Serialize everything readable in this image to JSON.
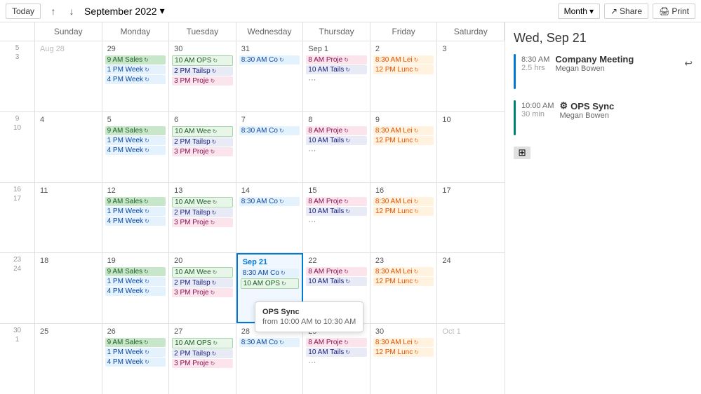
{
  "toolbar": {
    "today_label": "Today",
    "nav_up": "↑",
    "nav_down": "↓",
    "month_title": "September 2022",
    "month_dropdown": "▾",
    "share_label": "Share",
    "print_label": "Print",
    "view_label": "Month",
    "view_icon": "▾"
  },
  "panel": {
    "date": "Wed, Sep 21",
    "event1": {
      "time": "8:30 AM",
      "duration": "2.5 hrs",
      "title": "Company Meeting",
      "organizer": "Megan Bowen",
      "bar_color": "blue"
    },
    "event2": {
      "time": "10:00 AM",
      "duration": "30 min",
      "title": "OPS Sync",
      "organizer": "Megan Bowen",
      "bar_color": "teal"
    }
  },
  "day_headers": [
    "Sunday",
    "Monday",
    "Tuesday",
    "Wednesday",
    "Thursday",
    "Friday",
    "Saturday"
  ],
  "weeks": [
    {
      "nums": [
        "5",
        "3"
      ],
      "days": [
        {
          "label": "Aug 28",
          "other": true,
          "events": []
        },
        {
          "label": "29",
          "events": [
            {
              "text": "9 AM Sales",
              "cls": "event-sales",
              "recur": true
            },
            {
              "text": "1 PM Week",
              "cls": "event-week",
              "recur": true
            },
            {
              "text": "4 PM Week",
              "cls": "event-week",
              "recur": true
            }
          ]
        },
        {
          "label": "30",
          "events": [
            {
              "text": "10 AM OPS",
              "cls": "event-ops",
              "recur": true
            },
            {
              "text": "2 PM Tailsp",
              "cls": "event-tail",
              "recur": true
            },
            {
              "text": "3 PM Proje",
              "cls": "event-proj",
              "recur": true
            }
          ]
        },
        {
          "label": "31",
          "events": [
            {
              "text": "8:30 AM Co",
              "cls": "event-co",
              "recur": true
            }
          ]
        },
        {
          "label": "Sep 1",
          "events": [
            {
              "text": "8 AM Proje",
              "cls": "event-proj",
              "recur": true
            },
            {
              "text": "10 AM Tails",
              "cls": "event-tail",
              "recur": true
            },
            {
              "text": "···",
              "cls": "more-dots",
              "dots": true
            }
          ]
        },
        {
          "label": "2",
          "events": [
            {
              "text": "8:30 AM Lei",
              "cls": "event-lun",
              "recur": true
            },
            {
              "text": "12 PM Lunc",
              "cls": "event-lun",
              "recur": true
            }
          ]
        },
        {
          "label": "3",
          "events": []
        }
      ]
    },
    {
      "nums": [
        "9",
        "10"
      ],
      "days": [
        {
          "label": "4",
          "events": []
        },
        {
          "label": "5",
          "events": [
            {
              "text": "9 AM Sales",
              "cls": "event-sales",
              "recur": true
            },
            {
              "text": "1 PM Week",
              "cls": "event-week",
              "recur": true
            },
            {
              "text": "4 PM Week",
              "cls": "event-week",
              "recur": true
            }
          ]
        },
        {
          "label": "6",
          "events": [
            {
              "text": "10 AM Wee",
              "cls": "event-ops",
              "recur": true
            },
            {
              "text": "2 PM Tailsp",
              "cls": "event-tail",
              "recur": true
            },
            {
              "text": "3 PM Proje",
              "cls": "event-proj",
              "recur": true
            }
          ]
        },
        {
          "label": "7",
          "events": [
            {
              "text": "8:30 AM Co",
              "cls": "event-co",
              "recur": true
            }
          ]
        },
        {
          "label": "8",
          "events": [
            {
              "text": "8 AM Proje",
              "cls": "event-proj",
              "recur": true
            },
            {
              "text": "10 AM Tails",
              "cls": "event-tail",
              "recur": true
            },
            {
              "text": "···",
              "cls": "more-dots",
              "dots": true
            }
          ]
        },
        {
          "label": "9",
          "events": [
            {
              "text": "8:30 AM Lei",
              "cls": "event-lun",
              "recur": true
            },
            {
              "text": "12 PM Lunc",
              "cls": "event-lun",
              "recur": true
            }
          ]
        },
        {
          "label": "10",
          "events": []
        }
      ]
    },
    {
      "nums": [
        "16",
        "17"
      ],
      "days": [
        {
          "label": "11",
          "events": []
        },
        {
          "label": "12",
          "events": [
            {
              "text": "9 AM Sales",
              "cls": "event-sales",
              "recur": true
            },
            {
              "text": "1 PM Week",
              "cls": "event-week",
              "recur": true
            },
            {
              "text": "4 PM Week",
              "cls": "event-week",
              "recur": true
            }
          ]
        },
        {
          "label": "13",
          "events": [
            {
              "text": "10 AM Wee",
              "cls": "event-ops",
              "recur": true
            },
            {
              "text": "2 PM Tailsp",
              "cls": "event-tail",
              "recur": true
            },
            {
              "text": "3 PM Proje",
              "cls": "event-proj",
              "recur": true
            }
          ]
        },
        {
          "label": "14",
          "events": [
            {
              "text": "8:30 AM Co",
              "cls": "event-co",
              "recur": true
            }
          ]
        },
        {
          "label": "15",
          "events": [
            {
              "text": "8 AM Proje",
              "cls": "event-proj",
              "recur": true
            },
            {
              "text": "10 AM Tails",
              "cls": "event-tail",
              "recur": true
            },
            {
              "text": "···",
              "cls": "more-dots",
              "dots": true
            }
          ]
        },
        {
          "label": "16",
          "events": [
            {
              "text": "8:30 AM Lei",
              "cls": "event-lun",
              "recur": true
            },
            {
              "text": "12 PM Lunc",
              "cls": "event-lun",
              "recur": true
            }
          ]
        },
        {
          "label": "17",
          "events": []
        }
      ]
    },
    {
      "nums": [
        "23",
        "24"
      ],
      "days": [
        {
          "label": "18",
          "events": []
        },
        {
          "label": "19",
          "events": [
            {
              "text": "9 AM Sales",
              "cls": "event-sales",
              "recur": true
            },
            {
              "text": "1 PM Week",
              "cls": "event-week",
              "recur": true
            },
            {
              "text": "4 PM Week",
              "cls": "event-week",
              "recur": true
            }
          ]
        },
        {
          "label": "20",
          "events": [
            {
              "text": "10 AM Wee",
              "cls": "event-ops",
              "recur": true
            },
            {
              "text": "2 PM Tailsp",
              "cls": "event-tail",
              "recur": true
            },
            {
              "text": "3 PM Proje",
              "cls": "event-proj",
              "recur": true
            }
          ]
        },
        {
          "label": "Sep 21",
          "today": true,
          "events": [
            {
              "text": "8:30 AM Co",
              "cls": "event-co",
              "recur": true
            },
            {
              "text": "10 AM OPS",
              "cls": "event-ops",
              "recur": true,
              "tooltip": true
            }
          ]
        },
        {
          "label": "22",
          "events": [
            {
              "text": "8 AM Proje",
              "cls": "event-proj",
              "recur": true
            },
            {
              "text": "10 AM Tails",
              "cls": "event-tail",
              "recur": true
            }
          ]
        },
        {
          "label": "23",
          "events": [
            {
              "text": "8:30 AM Lei",
              "cls": "event-lun",
              "recur": true
            },
            {
              "text": "12 PM Lunc",
              "cls": "event-lun",
              "recur": true
            }
          ]
        },
        {
          "label": "24",
          "events": []
        }
      ]
    },
    {
      "nums": [
        "30",
        "1"
      ],
      "days": [
        {
          "label": "25",
          "events": []
        },
        {
          "label": "26",
          "events": [
            {
              "text": "9 AM Sales",
              "cls": "event-sales",
              "recur": true
            },
            {
              "text": "1 PM Week",
              "cls": "event-week",
              "recur": true
            },
            {
              "text": "4 PM Week",
              "cls": "event-week",
              "recur": true
            }
          ]
        },
        {
          "label": "27",
          "events": [
            {
              "text": "10 AM OPS",
              "cls": "event-ops",
              "recur": true
            },
            {
              "text": "2 PM Tailsp",
              "cls": "event-tail",
              "recur": true
            },
            {
              "text": "3 PM Proje",
              "cls": "event-proj",
              "recur": true
            }
          ]
        },
        {
          "label": "28",
          "events": [
            {
              "text": "8:30 AM Co",
              "cls": "event-co",
              "recur": true
            }
          ]
        },
        {
          "label": "29",
          "events": [
            {
              "text": "8 AM Proje",
              "cls": "event-proj",
              "recur": true
            },
            {
              "text": "10 AM Tails",
              "cls": "event-tail",
              "recur": true
            },
            {
              "text": "···",
              "cls": "more-dots",
              "dots": true
            }
          ]
        },
        {
          "label": "30",
          "events": [
            {
              "text": "8:30 AM Lei",
              "cls": "event-lun",
              "recur": true
            },
            {
              "text": "12 PM Lunc",
              "cls": "event-lun",
              "recur": true
            }
          ]
        },
        {
          "label": "Oct 1",
          "other": true,
          "events": []
        }
      ]
    }
  ],
  "tooltip": {
    "title": "OPS Sync",
    "time": "from 10:00 AM to 10:30 AM"
  }
}
